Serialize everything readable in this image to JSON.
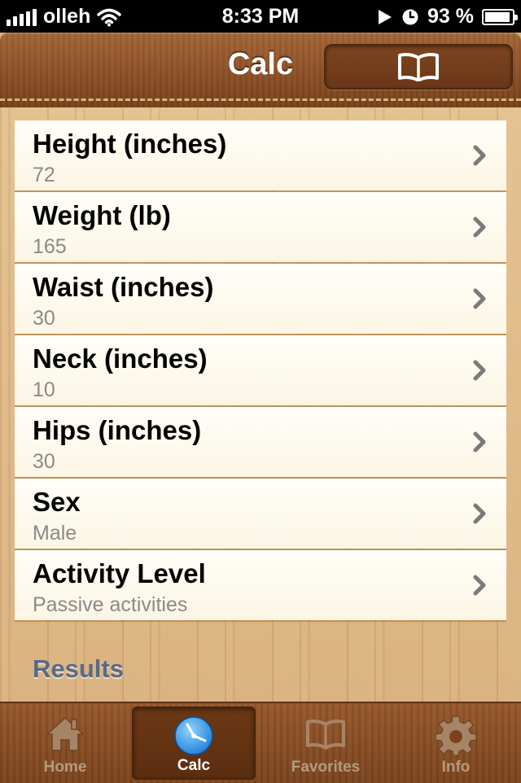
{
  "status_bar": {
    "carrier": "olleh",
    "time": "8:33 PM",
    "battery_percent": "93 %",
    "battery_level": 0.93
  },
  "nav": {
    "title": "Calc",
    "right_button_icon": "book-icon"
  },
  "rows": [
    {
      "label": "Height (inches)",
      "value": "72"
    },
    {
      "label": "Weight (lb)",
      "value": "165"
    },
    {
      "label": "Waist (inches)",
      "value": "30"
    },
    {
      "label": "Neck (inches)",
      "value": "10"
    },
    {
      "label": "Hips (inches)",
      "value": "30"
    },
    {
      "label": "Sex",
      "value": "Male"
    },
    {
      "label": "Activity Level",
      "value": "Passive activities"
    }
  ],
  "results_header": "Results",
  "tabs": [
    {
      "label": "Home",
      "icon": "home-icon",
      "active": false
    },
    {
      "label": "Calc",
      "icon": "clock-icon",
      "active": true
    },
    {
      "label": "Favorites",
      "icon": "book-icon",
      "active": false
    },
    {
      "label": "Info",
      "icon": "gear-icon",
      "active": false
    }
  ],
  "colors": {
    "leather": "#8c5027",
    "wood": "#dcb37e",
    "results_text": "#5a6a86",
    "value_text": "#8a8a8a"
  }
}
